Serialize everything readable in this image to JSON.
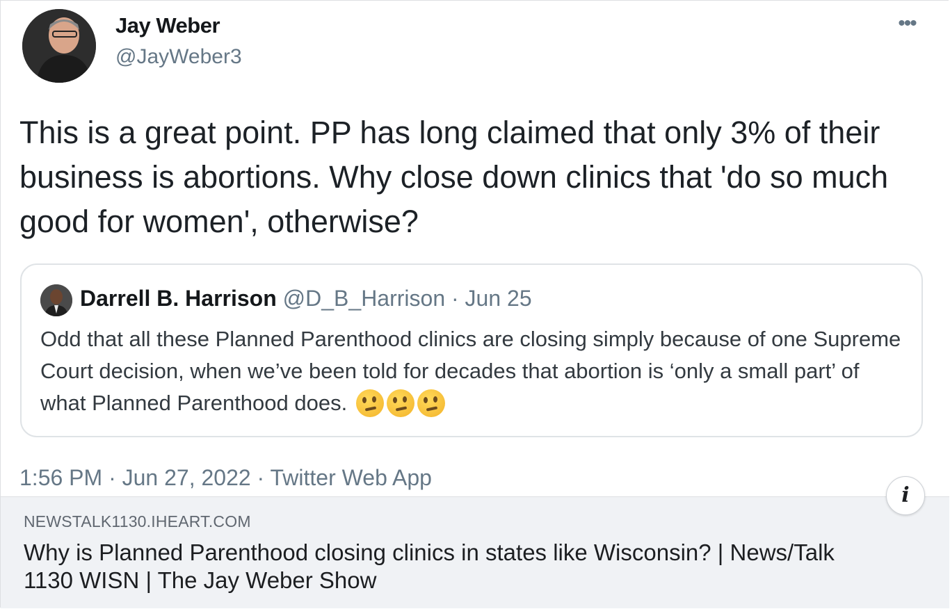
{
  "tweet": {
    "display_name": "Jay Weber",
    "handle": "@JayWeber3",
    "more_icon": "more-horizontal-icon",
    "text": "This is a great point. PP has long claimed that only 3% of their business is abortions. Why close down clinics that 'do so much good for women', otherwise?",
    "timestamp": "1:56 PM · Jun 27, 2022 · Twitter Web App"
  },
  "quoted_tweet": {
    "display_name": "Darrell B. Harrison",
    "handle": "@D_B_Harrison",
    "date": " · Jun 25",
    "text": "Odd that all these Planned Parenthood clinics are closing simply because of one Supreme Court decision, when we’ve been told for decades that abortion is ‘only a small part’ of what Planned Parenthood does.",
    "emojis": [
      "thinking-face-icon",
      "thinking-face-icon",
      "thinking-face-icon"
    ]
  },
  "link_card": {
    "domain": "NEWSTALK1130.IHEART.COM",
    "headline": "Why is Planned Parenthood closing clinics in states like Wisconsin? | News/Talk 1130 WISN | The Jay Weber Show",
    "info_label": "i"
  }
}
